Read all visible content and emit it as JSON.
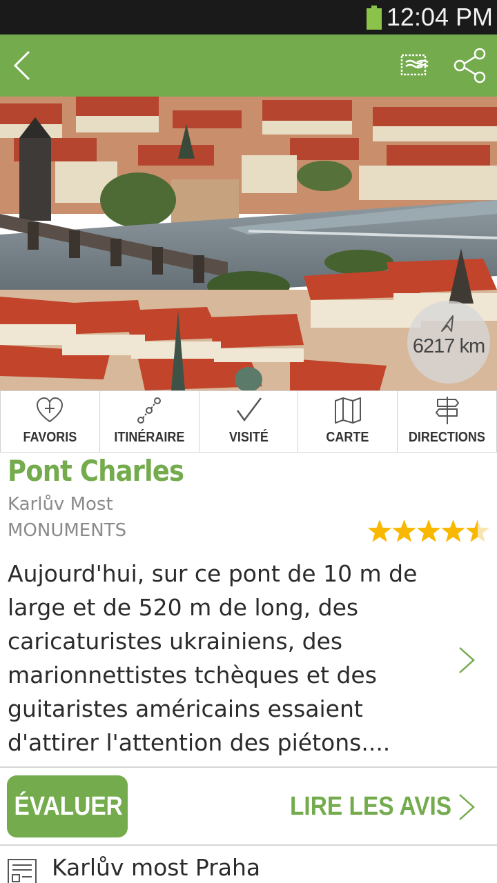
{
  "status_bar": {
    "time": "12:04 PM"
  },
  "header": {
    "back_icon": "chevron-left-icon",
    "postcard_icon": "postcard-icon",
    "share_icon": "share-icon"
  },
  "hero": {
    "distance": "6217 km",
    "distance_icon": "navigation-arrow-icon"
  },
  "actions": [
    {
      "label": "FAVORIS",
      "icon": "heart-plus-icon"
    },
    {
      "label": "ITINÉRAIRE",
      "icon": "route-icon"
    },
    {
      "label": "VISITÉ",
      "icon": "checkmark-icon"
    },
    {
      "label": "CARTE",
      "icon": "map-icon"
    },
    {
      "label": "DIRECTIONS",
      "icon": "signpost-icon"
    }
  ],
  "place": {
    "title": "Pont Charles",
    "local_name": "Karlův Most",
    "category": "MONUMENTS",
    "rating": 4.5,
    "rating_max": 5,
    "description": "Aujourd'hui, sur ce pont de 10 m de large et de 520 m de long, des caricaturistes ukrainiens, des marionnettistes tchèques et des guitaristes américains essaient d'attirer l'attention des piétons...."
  },
  "reviews": {
    "rate_label": "ÉVALUER",
    "read_label": "LIRE LES AVIS"
  },
  "address": {
    "text": "Karlův most Praha",
    "icon": "address-card-icon"
  },
  "colors": {
    "accent": "#74ab4d",
    "star": "#f9b800",
    "status_bar": "#1a1a1a"
  }
}
